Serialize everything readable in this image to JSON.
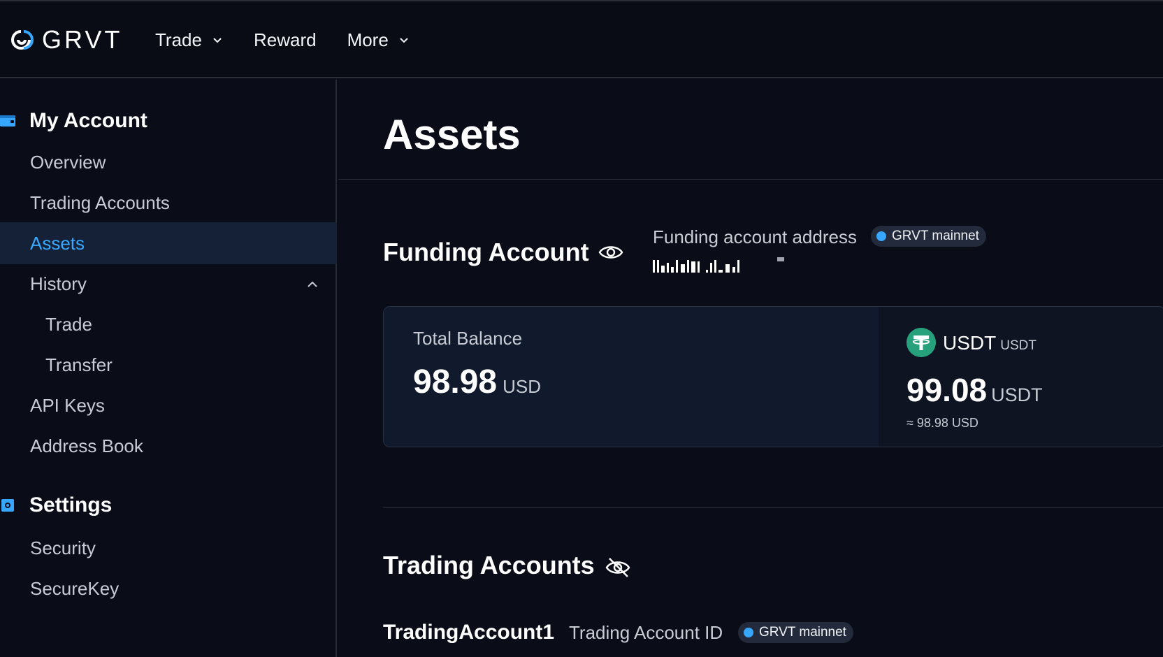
{
  "brand": {
    "name": "GRVT"
  },
  "nav": {
    "items": [
      {
        "label": "Trade",
        "has_dropdown": true
      },
      {
        "label": "Reward",
        "has_dropdown": false
      },
      {
        "label": "More",
        "has_dropdown": true
      }
    ]
  },
  "sidebar": {
    "my_account": {
      "title": "My Account",
      "icon": "wallet-icon",
      "items": {
        "overview": "Overview",
        "trading_accounts": "Trading Accounts",
        "assets": "Assets",
        "history": "History",
        "history_trade": "Trade",
        "history_transfer": "Transfer",
        "api_keys": "API Keys",
        "address_book": "Address Book"
      }
    },
    "settings": {
      "title": "Settings",
      "icon": "settings-icon",
      "items": {
        "security": "Security",
        "securekey": "SecureKey"
      }
    },
    "active_item": "Assets"
  },
  "main": {
    "page_title": "Assets",
    "funding": {
      "title": "Funding Account",
      "address_label": "Funding account address",
      "network_badge": "GRVT mainnet",
      "total_balance_label": "Total Balance",
      "total_balance_value": "98.98",
      "total_balance_unit": "USD",
      "asset": {
        "name": "USDT",
        "symbol": "USDT",
        "amount": "99.08",
        "unit": "USDT",
        "approx": "≈ 98.98 USD"
      }
    },
    "trading": {
      "title": "Trading Accounts",
      "account_name": "TradingAccount1",
      "id_label": "Trading Account ID",
      "network_badge": "GRVT mainnet"
    }
  },
  "colors": {
    "background": "#0a0d17",
    "accent": "#38a9ff",
    "active_bg": "#142137",
    "usdt_green": "#26a17b"
  }
}
